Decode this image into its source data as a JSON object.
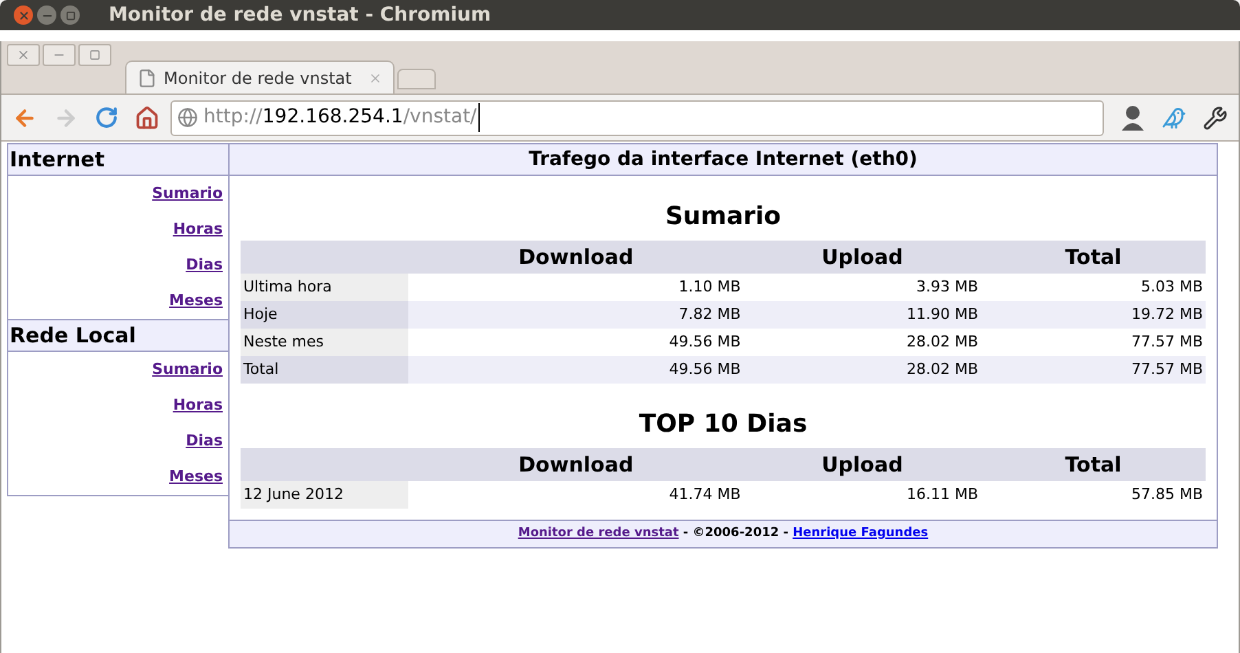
{
  "window": {
    "title": "Monitor de rede vnstat - Chromium"
  },
  "tabs": [
    {
      "label": "Monitor de rede vnstat",
      "selected": true
    }
  ],
  "address_bar": {
    "url_parts": [
      {
        "text": "http://",
        "kind": "dim"
      },
      {
        "text": "192.168.254.1",
        "kind": "host"
      },
      {
        "text": "/vnstat/",
        "kind": "dim"
      }
    ]
  },
  "toolbar": {
    "forward_disabled": true
  },
  "sidebar": {
    "sections": [
      {
        "title": "Internet",
        "links": [
          {
            "label": "Sumario",
            "visited": true
          },
          {
            "label": "Horas",
            "visited": true
          },
          {
            "label": "Dias",
            "visited": true
          },
          {
            "label": "Meses",
            "visited": true
          }
        ]
      },
      {
        "title": "Rede Local",
        "links": [
          {
            "label": "Sumario",
            "visited": true
          },
          {
            "label": "Horas",
            "visited": true
          },
          {
            "label": "Dias",
            "visited": true
          },
          {
            "label": "Meses",
            "visited": true
          }
        ]
      }
    ]
  },
  "main": {
    "header": "Trafego da interface Internet (eth0)",
    "tables": [
      {
        "title": "Sumario",
        "columns": [
          "Download",
          "Upload",
          "Total"
        ],
        "rows": [
          {
            "label": "Ultima hora",
            "cells": [
              "1.10 MB",
              "3.93 MB",
              "5.03 MB"
            ]
          },
          {
            "label": "Hoje",
            "cells": [
              "7.82 MB",
              "11.90 MB",
              "19.72 MB"
            ]
          },
          {
            "label": "Neste mes",
            "cells": [
              "49.56 MB",
              "28.02 MB",
              "77.57 MB"
            ]
          },
          {
            "label": "Total",
            "cells": [
              "49.56 MB",
              "28.02 MB",
              "77.57 MB"
            ]
          }
        ]
      },
      {
        "title": "TOP 10 Dias",
        "columns": [
          "Download",
          "Upload",
          "Total"
        ],
        "rows": [
          {
            "label": "12 June 2012",
            "cells": [
              "41.74 MB",
              "16.11 MB",
              "57.85 MB"
            ]
          }
        ]
      }
    ],
    "footer": {
      "link1": {
        "label": "Monitor de rede vnstat",
        "visited": true
      },
      "text": " - ©2006-2012 - ",
      "link2": {
        "label": "Henrique Fagundes",
        "visited": false
      }
    }
  }
}
